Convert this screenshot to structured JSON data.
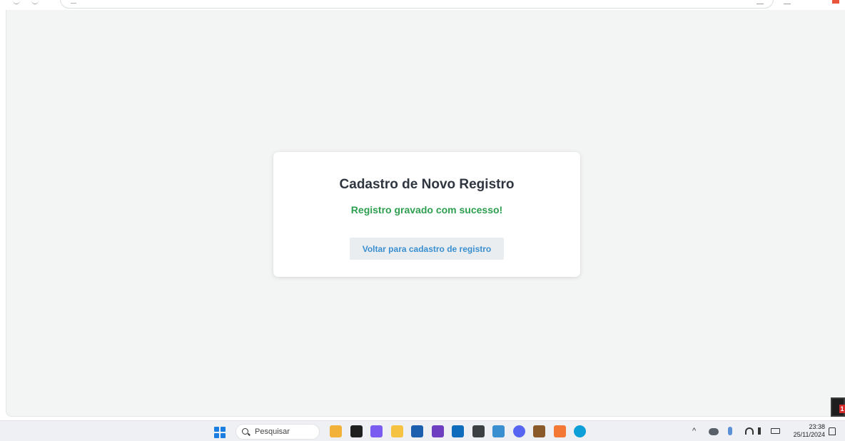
{
  "page": {
    "title": "Cadastro de Novo Registro",
    "message": "Registro gravado com sucesso!",
    "back_button_label": "Voltar para cadastro de registro"
  },
  "notification_badge": {
    "count": "1"
  },
  "taskbar": {
    "search_placeholder": "Pesquisar",
    "pinned_apps": [
      {
        "icon": "paint-icon",
        "color": "#f2b23a"
      },
      {
        "icon": "task-view-icon",
        "color": "#1f1f1f"
      },
      {
        "icon": "copilot-icon",
        "color": "#7b5cf0"
      },
      {
        "icon": "file-explorer-icon",
        "color": "#f5c242"
      },
      {
        "icon": "store-icon",
        "color": "#1b5fae"
      },
      {
        "icon": "visual-studio-icon",
        "color": "#6d3fc0"
      },
      {
        "icon": "outlook-icon",
        "color": "#0f6cbd"
      },
      {
        "icon": "terminal-icon",
        "color": "#3c4043"
      },
      {
        "icon": "photos-icon",
        "color": "#3a8fd0"
      },
      {
        "icon": "discord-icon",
        "color": "#5865f2"
      },
      {
        "icon": "minecraft-icon",
        "color": "#8b5a2b"
      },
      {
        "icon": "xampp-icon",
        "color": "#f37735"
      },
      {
        "icon": "edge-icon",
        "color": "#0c9fd8"
      }
    ],
    "tray": {
      "chevron": "^",
      "wifi_icon": "wifi-icon",
      "volume_icon": "volume-icon",
      "battery_icon": "battery-icon"
    },
    "clock": {
      "time": "23:38",
      "date": "25/11/2024"
    }
  }
}
